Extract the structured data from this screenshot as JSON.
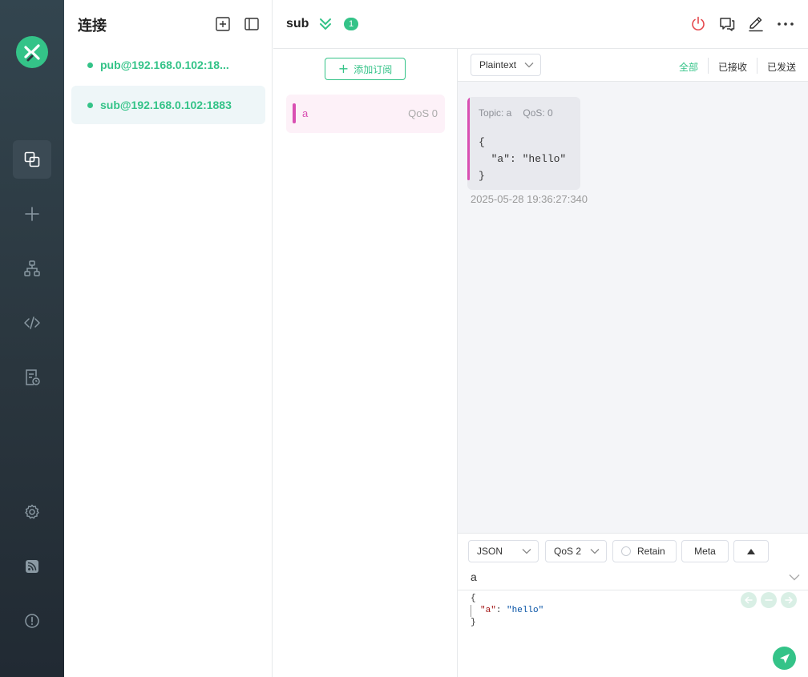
{
  "sidebar": {
    "title": "连接",
    "connections": [
      {
        "label": "pub@192.168.0.102:18...",
        "status_color": "#34c388"
      },
      {
        "label": "sub@192.168.0.102:1883",
        "status_color": "#34c388"
      }
    ]
  },
  "topbar": {
    "title": "sub",
    "badge_count": "1"
  },
  "subscriptions": {
    "add_label": "添加订阅",
    "items": [
      {
        "topic": "a",
        "qos": "QoS 0",
        "color": "#d94fb2"
      }
    ]
  },
  "messages": {
    "format": "Plaintext",
    "filters": {
      "all": "全部",
      "received": "已接收",
      "sent": "已发送"
    },
    "list": [
      {
        "topic_label": "Topic: a",
        "qos_label": "QoS: 0",
        "payload": "{\n  \"a\": \"hello\"\n}",
        "time": "2025-05-28 19:36:27:340"
      }
    ]
  },
  "compose": {
    "format": "JSON",
    "qos": "QoS 2",
    "retain_label": "Retain",
    "meta_label": "Meta",
    "topic": "a",
    "payload": {
      "open": "{",
      "key": "\"a\"",
      "colon": ": ",
      "value": "\"hello\"",
      "close": "}"
    }
  },
  "colors": {
    "accent": "#34c388",
    "topic": "#d94fb2",
    "danger": "#e5484d",
    "rail": "#2a363e"
  }
}
